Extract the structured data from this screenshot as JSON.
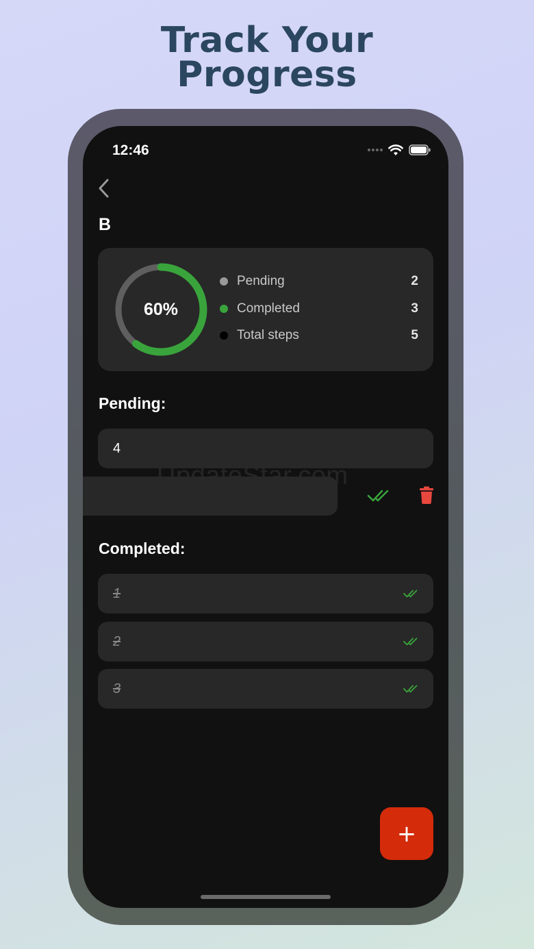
{
  "headline": {
    "line1": "Track Your",
    "line2": "Progress"
  },
  "status_bar": {
    "time": "12:46"
  },
  "page": {
    "title": "B"
  },
  "summary": {
    "percent_label": "60%",
    "progress_fraction": 0.6,
    "legend": [
      {
        "label": "Pending",
        "value": "2",
        "color": "#9a9a9a"
      },
      {
        "label": "Completed",
        "value": "3",
        "color": "#3aa43c"
      },
      {
        "label": "Total steps",
        "value": "5",
        "color": "#000000"
      }
    ],
    "colors": {
      "ring_done": "#3aa43c",
      "ring_pending": "#5f5f5f"
    }
  },
  "pending": {
    "section_label": "Pending:",
    "items": [
      {
        "text": "4"
      },
      {
        "text": ""
      }
    ]
  },
  "completed": {
    "section_label": "Completed:",
    "items": [
      {
        "text": "1"
      },
      {
        "text": "2"
      },
      {
        "text": "3"
      }
    ]
  },
  "watermark": "UpdateStar.com",
  "colors": {
    "accent_green": "#3aa43c",
    "delete_red": "#e8473e",
    "fab_bg": "#d42b0b"
  }
}
